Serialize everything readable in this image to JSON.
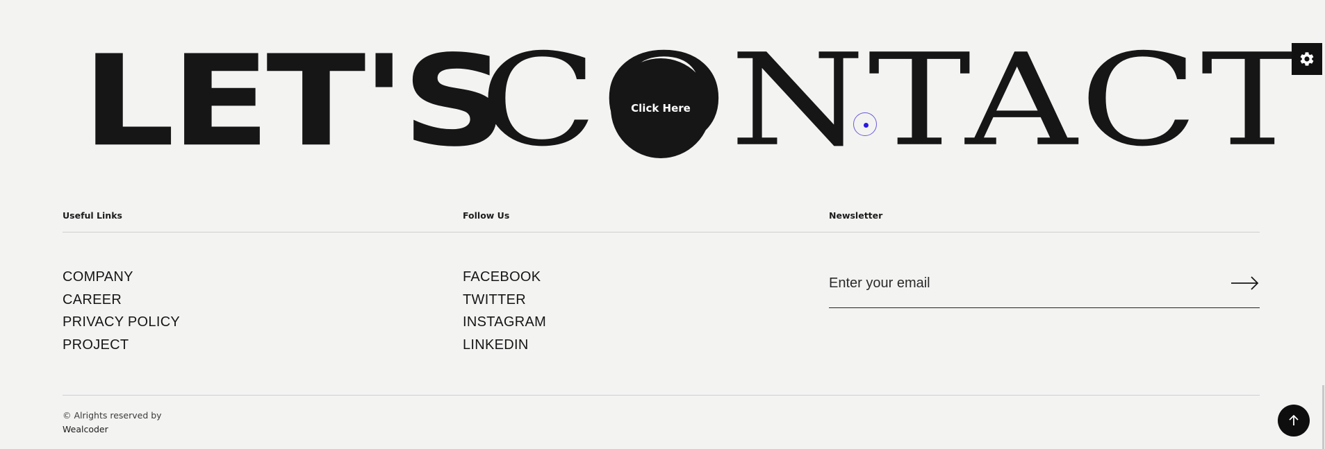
{
  "hero": {
    "word1": "LET'S",
    "word2": "CONTACT",
    "cta_label": "Click Here"
  },
  "settings": {
    "icon": "gear-icon"
  },
  "columns": {
    "useful_links": {
      "title": "Useful Links",
      "items": [
        "COMPANY",
        "CAREER",
        "PRIVACY POLICY",
        "PROJECT"
      ]
    },
    "follow_us": {
      "title": "Follow Us",
      "items": [
        "FACEBOOK",
        "TWITTER",
        "INSTAGRAM",
        "LINKEDIN"
      ]
    },
    "newsletter": {
      "title": "Newsletter",
      "placeholder": "Enter your email",
      "value": "",
      "submit_icon": "arrow-right-icon"
    }
  },
  "footer": {
    "copyright": "© Alrights reserved by",
    "brand": "Wealcoder",
    "back_to_top_icon": "arrow-up-icon"
  },
  "colors": {
    "background": "#f3f3f2",
    "text": "#161616",
    "accent_cursor": "#2a1ae0"
  }
}
